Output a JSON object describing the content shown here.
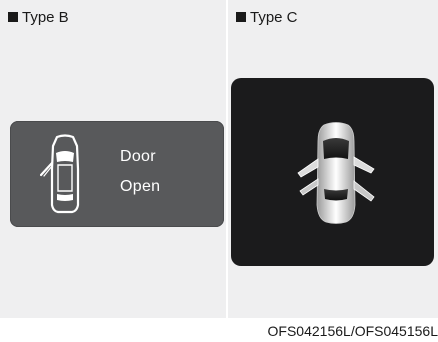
{
  "type_b": {
    "label": "Type B",
    "display_text_line1": "Door",
    "display_text_line2": "Open"
  },
  "type_c": {
    "label": "Type C"
  },
  "caption": "OFS042156L/OFS045156L",
  "colors": {
    "panel_bg": "#efeff0",
    "display_b_bg": "#58595b",
    "display_c_bg": "#1b1b1c",
    "text": "#1a1a1a",
    "display_text": "#ffffff"
  },
  "icons": {
    "type_b": "car-door-open-outline-icon",
    "type_c": "car-doors-open-3d-icon"
  }
}
